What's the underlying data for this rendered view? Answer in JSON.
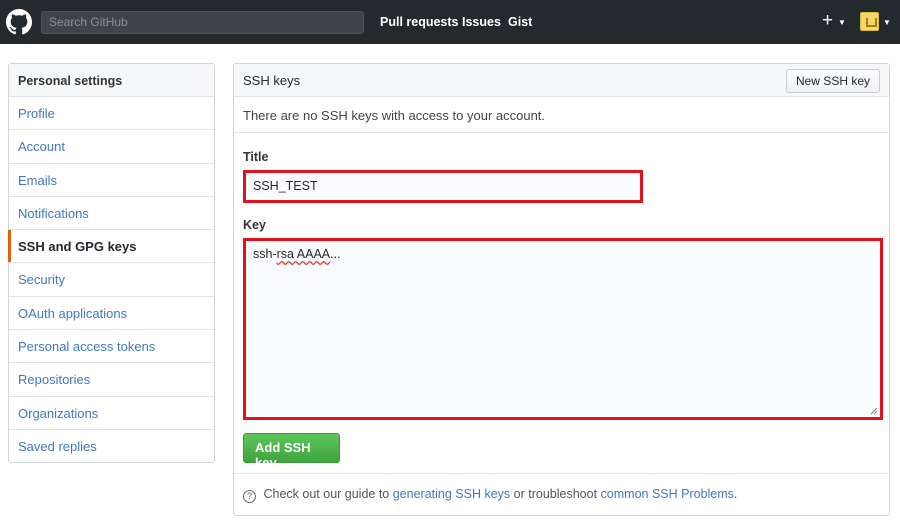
{
  "header": {
    "search_placeholder": "Search GitHub",
    "nav": [
      "Pull requests",
      "Issues",
      "Gist"
    ],
    "plus_label": "+",
    "icons": {
      "logo": "github-octocat-icon",
      "new": "plus-icon",
      "avatar": "user-avatar"
    }
  },
  "sidebar": {
    "title": "Personal settings",
    "items": [
      {
        "label": "Profile"
      },
      {
        "label": "Account"
      },
      {
        "label": "Emails"
      },
      {
        "label": "Notifications"
      },
      {
        "label": "SSH and GPG keys",
        "active": true
      },
      {
        "label": "Security"
      },
      {
        "label": "OAuth applications"
      },
      {
        "label": "Personal access tokens"
      },
      {
        "label": "Repositories"
      },
      {
        "label": "Organizations"
      },
      {
        "label": "Saved replies"
      }
    ]
  },
  "main": {
    "title": "SSH keys",
    "new_key_button": "New SSH key",
    "empty_message": "There are no SSH keys with access to your account.",
    "title_label": "Title",
    "title_value": "SSH_TEST",
    "key_label": "Key",
    "key_value_prefix": "ssh-",
    "key_value_misspelled": "rsa AAAA",
    "key_value_suffix": "...",
    "add_button": "Add SSH key",
    "footer": {
      "text_before": "Check out our guide to",
      "link1": "generating SSH keys",
      "text_middle": "or troubleshoot",
      "link2": "common SSH Problems",
      "text_after": "."
    }
  },
  "colors": {
    "header_bg": "#24292e",
    "link": "#4078c0",
    "highlight_border": "#e0121b",
    "add_button": "#4caf50",
    "active_marker": "#e36209"
  }
}
